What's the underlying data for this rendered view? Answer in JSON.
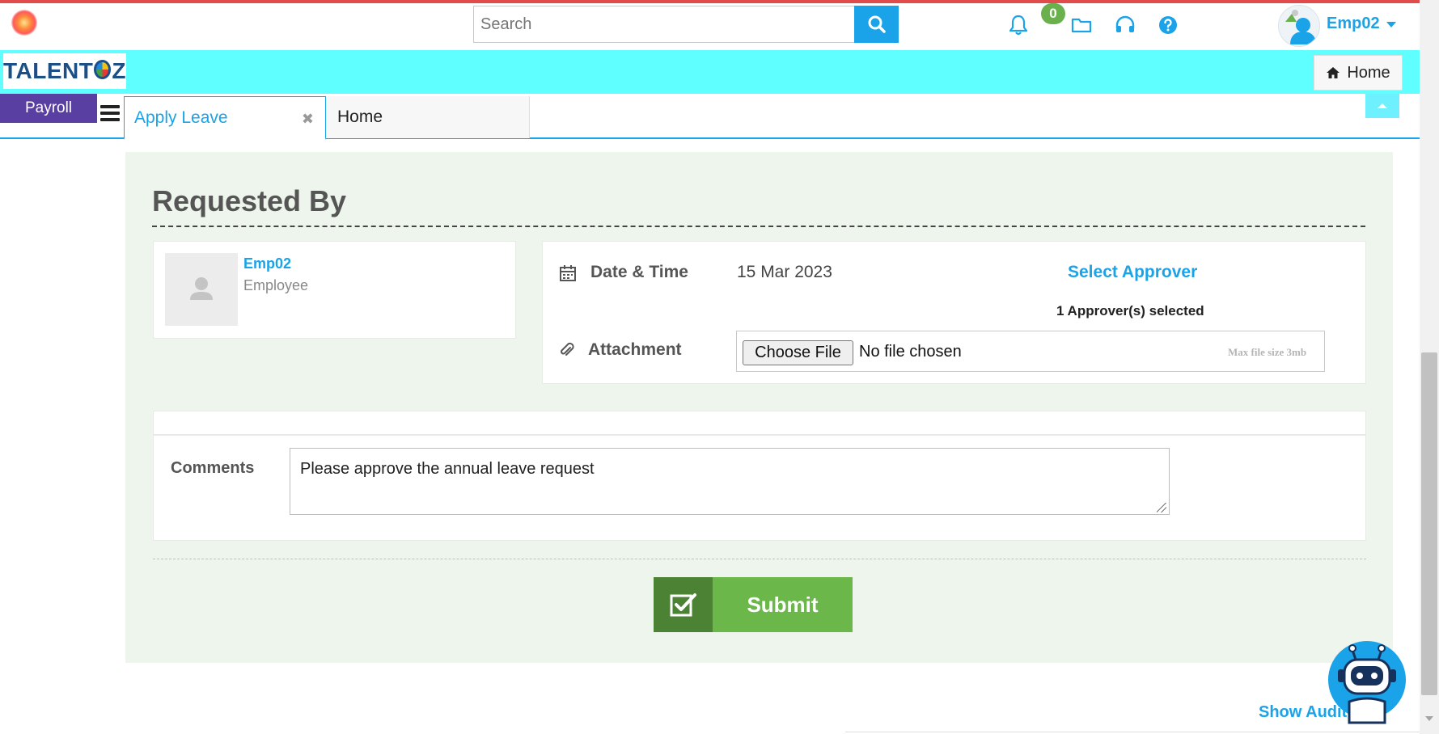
{
  "header": {
    "search": {
      "placeholder": "Search",
      "value": ""
    },
    "notifications": {
      "count": "0"
    },
    "user": {
      "name": "Emp02"
    }
  },
  "brand": {
    "logo_text_left": "TALENT",
    "logo_text_right": "Z",
    "home_label": "Home"
  },
  "nav": {
    "module_label": "Payroll",
    "tabs": [
      {
        "label": "Apply Leave",
        "active": true
      },
      {
        "label": "Home",
        "active": false
      }
    ]
  },
  "form": {
    "section_title": "Requested By",
    "requester": {
      "name": "Emp02",
      "role": "Employee"
    },
    "date_time": {
      "label": "Date & Time",
      "value": "15 Mar 2023"
    },
    "approver": {
      "link_label": "Select Approver",
      "selected_text": "1 Approver(s) selected"
    },
    "attachment": {
      "label": "Attachment",
      "button_label": "Choose File",
      "status_text": "No file chosen",
      "hint": "Max file size 3mb"
    },
    "comments": {
      "label": "Comments",
      "value": "Please approve the annual leave request"
    },
    "submit_label": "Submit"
  },
  "footer": {
    "show_audit_label": "Show Audit"
  },
  "colors": {
    "accent": "#1aa3e8",
    "cyan_bar": "#5fffff",
    "payroll": "#5a3fa3",
    "panel_bg": "#edf5ec",
    "submit_dark": "#4c8233",
    "submit_light": "#6bb74a",
    "top_line": "#e24b4b"
  }
}
